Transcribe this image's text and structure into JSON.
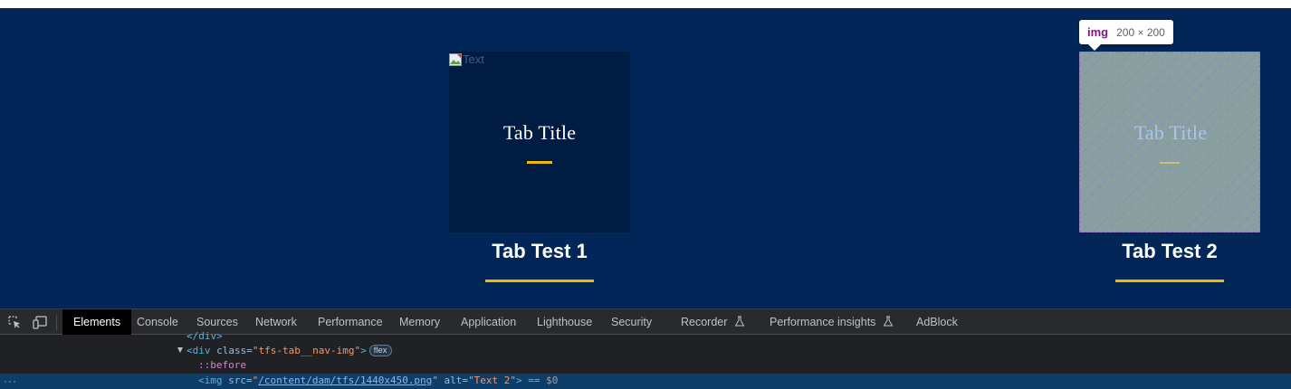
{
  "page": {
    "tab_1": {
      "tile_alt": "Text",
      "tile_title": "Tab Title",
      "label": "Tab Test 1"
    },
    "tab_2": {
      "tile_title": "Tab Title",
      "label": "Tab Test 2"
    },
    "colors": {
      "page_background": "#012657",
      "tile_background": "#001c42",
      "accent": "#f2b807",
      "highlight_overlay": "#8a9fa0"
    }
  },
  "inspector_tooltip": {
    "tag": "img",
    "size": "200 × 200"
  },
  "devtools": {
    "tabs": [
      {
        "label": "Elements",
        "active": true
      },
      {
        "label": "Console"
      },
      {
        "label": "Sources"
      },
      {
        "label": "Network"
      },
      {
        "label": "Performance"
      },
      {
        "label": "Memory"
      },
      {
        "label": "Application"
      },
      {
        "label": "Lighthouse"
      },
      {
        "label": "Security"
      },
      {
        "label": "Recorder",
        "icon": "flask-icon"
      },
      {
        "label": "Performance insights",
        "icon": "flask-icon"
      },
      {
        "label": "AdBlock"
      }
    ],
    "icons": {
      "inspect": "inspect-element-icon",
      "device": "device-toolbar-icon"
    },
    "tree": {
      "line_1_close_tag": "</div>",
      "line_2": {
        "open": "<div",
        "attr_name": " class=",
        "attr_value": "\"tfs-tab__nav-img\"",
        "close": ">",
        "badge": "flex"
      },
      "line_3_pseudo": "::before",
      "line_4": {
        "ellipsis": "···",
        "open": "<img",
        "src_name": " src=",
        "src_quote_open": "\"",
        "src_value": "/content/dam/tfs/1440x450.png",
        "src_quote_close": "\"",
        "alt_name": " alt=",
        "alt_value": "\"Text 2\"",
        "close": ">",
        "suffix": " == $0"
      }
    }
  }
}
